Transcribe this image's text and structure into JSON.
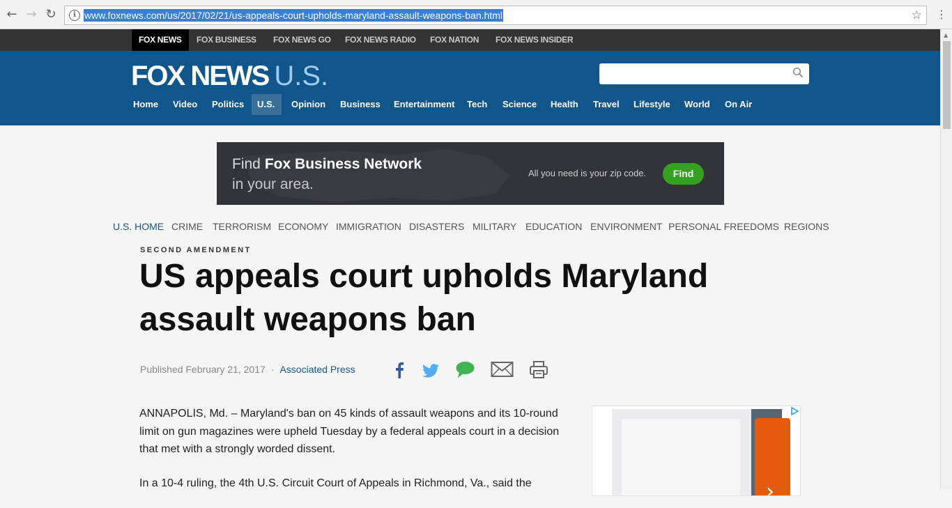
{
  "browser": {
    "url": "www.foxnews.com/us/2017/02/21/us-appeals-court-upholds-maryland-assault-weapons-ban.html",
    "back_icon": "back-arrow-icon",
    "forward_icon": "forward-arrow-icon",
    "reload_icon": "reload-icon"
  },
  "network_bar": {
    "items": [
      "FOX NEWS",
      "FOX BUSINESS",
      "FOX NEWS GO",
      "FOX NEWS RADIO",
      "FOX NATION",
      "FOX NEWS INSIDER"
    ]
  },
  "header": {
    "logo": "FOX NEWS",
    "logo_section": "U.S.",
    "nav": [
      "Home",
      "Video",
      "Politics",
      "U.S.",
      "Opinion",
      "Business",
      "Entertainment",
      "Tech",
      "Science",
      "Health",
      "Travel",
      "Lifestyle",
      "World",
      "On Air"
    ],
    "active_nav": "U.S."
  },
  "ad_banner": {
    "find": "Find",
    "brand": "Fox Business Network",
    "line2": "in your area.",
    "zip_text": "All you need is your zip code.",
    "button": "Find",
    "button_color": "#35a121"
  },
  "section_nav": {
    "items": [
      "U.S. HOME",
      "CRIME",
      "TERRORISM",
      "ECONOMY",
      "IMMIGRATION",
      "DISASTERS",
      "MILITARY",
      "EDUCATION",
      "ENVIRONMENT",
      "PERSONAL FREEDOMS",
      "REGIONS"
    ]
  },
  "article": {
    "eyebrow": "SECOND AMENDMENT",
    "headline": "US appeals court upholds Maryland assault weapons ban",
    "published": "Published February 21, 2017",
    "separator": "·",
    "author": "Associated Press",
    "paragraphs": [
      "ANNAPOLIS, Md. –   Maryland's ban on 45 kinds of assault weapons and its 10-round limit on gun magazines were upheld Tuesday by a federal appeals court in a decision that met with a strongly worded dissent.",
      "In a 10-4 ruling, the 4th U.S. Circuit Court of Appeals in Richmond, Va., said the"
    ]
  },
  "colors": {
    "header_blue": "#10568a",
    "network_bar": "#333333",
    "link_blue": "#17558a",
    "facebook": "#3b5998",
    "twitter": "#55acee",
    "comment": "#3fb34f"
  }
}
